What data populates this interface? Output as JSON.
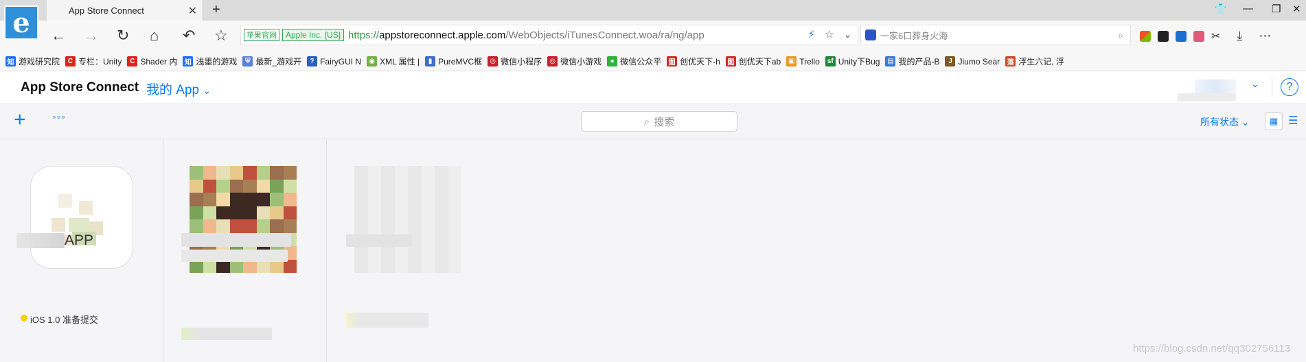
{
  "browser": {
    "tab_title": "App Store Connect",
    "address": {
      "badge_site": "苹果官网",
      "badge_org": "Apple Inc. [US]",
      "url_scheme": "https://",
      "url_host": "appstoreconnect.apple.com",
      "url_path": "/WebObjects/iTunesConnect.woa/ra/ng/app"
    },
    "search_placeholder": "一家6口葬身火海",
    "bookmarks": [
      {
        "label": "游戏研究院",
        "icon": "zhihu-icon",
        "color": "#1e6fff",
        "glyph": "知"
      },
      {
        "label": "专栏：Unity",
        "icon": "csdn-icon",
        "color": "#d9251c",
        "glyph": "C"
      },
      {
        "label": "Shader 内",
        "icon": "csdn-icon",
        "color": "#d9251c",
        "glyph": "C"
      },
      {
        "label": "浅墨的游戏",
        "icon": "zhihu-icon",
        "color": "#1e6fff",
        "glyph": "知"
      },
      {
        "label": "最新_游戏开",
        "icon": "shield-icon",
        "color": "#5b7fd6",
        "glyph": "⛨"
      },
      {
        "label": "FairyGUI N",
        "icon": "help-icon",
        "color": "#2d5fbf",
        "glyph": "?"
      },
      {
        "label": "XML 属性 |",
        "icon": "runoob-icon",
        "color": "#74b043",
        "glyph": "◉"
      },
      {
        "label": "PureMVC框",
        "icon": "book-icon",
        "color": "#3f6fc6",
        "glyph": "▮"
      },
      {
        "label": "微信小程序",
        "icon": "owl-icon",
        "color": "#c8202e",
        "glyph": "◎"
      },
      {
        "label": "微信小游戏",
        "icon": "owl-icon",
        "color": "#c8202e",
        "glyph": "◎"
      },
      {
        "label": "微信公众平",
        "icon": "wechat-icon",
        "color": "#2bb33b",
        "glyph": "●"
      },
      {
        "label": "创优天下-h",
        "icon": "brand-icon",
        "color": "#d52a2a",
        "glyph": "图"
      },
      {
        "label": "创优天下ab",
        "icon": "brand-icon",
        "color": "#d52a2a",
        "glyph": "图"
      },
      {
        "label": "Trello",
        "icon": "trello-icon",
        "color": "#e89a1c",
        "glyph": "▣"
      },
      {
        "label": "Unity下Bug",
        "icon": "sf-icon",
        "color": "#1d8a3a",
        "glyph": "sf"
      },
      {
        "label": "我的产品-B",
        "icon": "product-icon",
        "color": "#3a7bd5",
        "glyph": "▤"
      },
      {
        "label": "Jiumo Sear",
        "icon": "jiumo-icon",
        "color": "#7a5a2a",
        "glyph": "J"
      },
      {
        "label": "浮生六记, 浮",
        "icon": "book-icon",
        "color": "#d14b2a",
        "glyph": "落"
      }
    ]
  },
  "app": {
    "brand": "App Store Connect",
    "section": "我的 App",
    "search_placeholder": "搜索",
    "filter_label": "所有状态",
    "apps": [
      {
        "name_suffix": "APP",
        "status_text": "iOS 1.0 准备提交",
        "status_color": "#f3d400"
      },
      {
        "name_suffix": "",
        "status_text": "",
        "status_color": ""
      },
      {
        "name_suffix": "",
        "status_text": "",
        "status_color": ""
      }
    ]
  },
  "watermark": "https://blog.csdn.net/qq302756113",
  "colors": {
    "accent": "#0a7af5",
    "secure_green": "#2d9b4a"
  }
}
